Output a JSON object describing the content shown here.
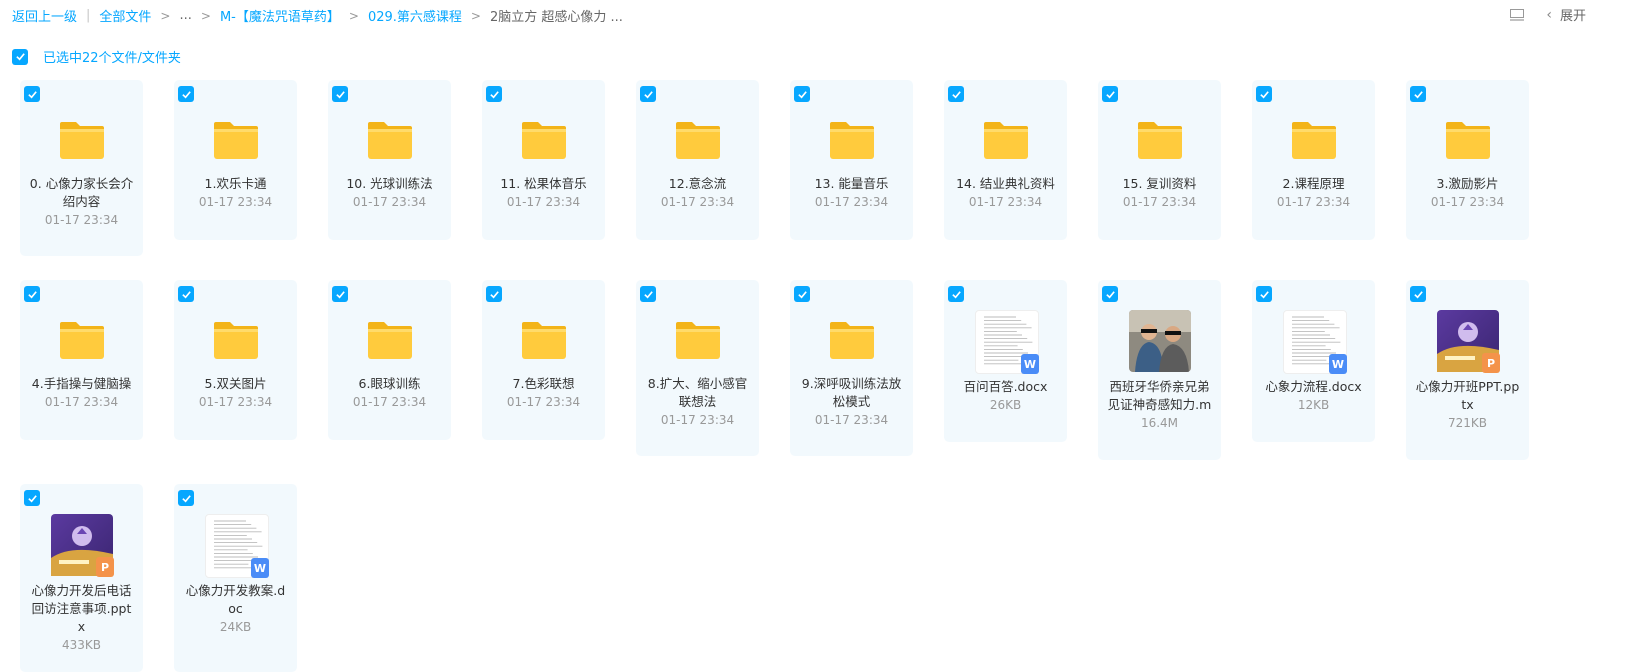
{
  "breadcrumb": {
    "back": "返回上一级",
    "all_files": "全部文件",
    "ellipsis": "...",
    "c1": "M-【魔法咒语草药】",
    "c2": "029.第六感课程",
    "current": "2脑立方 超感心像力 ..."
  },
  "toolbar": {
    "list_icon": "list-view-icon",
    "expand": "展开"
  },
  "selection": {
    "label": "已选中22个文件/文件夹"
  },
  "colors": {
    "accent": "#06a7ff",
    "card_bg": "#f2f9fd",
    "folder": "#ffc933"
  },
  "items": [
    {
      "name": "0. 心像力家长会介绍内容",
      "meta": "01-17 23:34",
      "kind": "folder"
    },
    {
      "name": "1.欢乐卡通",
      "meta": "01-17 23:34",
      "kind": "folder"
    },
    {
      "name": "10. 光球训练法",
      "meta": "01-17 23:34",
      "kind": "folder"
    },
    {
      "name": "11. 松果体音乐",
      "meta": "01-17 23:34",
      "kind": "folder"
    },
    {
      "name": "12.意念流",
      "meta": "01-17 23:34",
      "kind": "folder"
    },
    {
      "name": "13. 能量音乐",
      "meta": "01-17 23:34",
      "kind": "folder"
    },
    {
      "name": "14. 结业典礼资料",
      "meta": "01-17 23:34",
      "kind": "folder"
    },
    {
      "name": "15. 复训资料",
      "meta": "01-17 23:34",
      "kind": "folder"
    },
    {
      "name": "2.课程原理",
      "meta": "01-17 23:34",
      "kind": "folder"
    },
    {
      "name": "3.激励影片",
      "meta": "01-17 23:34",
      "kind": "folder"
    },
    {
      "name": "4.手指操与健脑操",
      "meta": "01-17 23:34",
      "kind": "folder"
    },
    {
      "name": "5.双关图片",
      "meta": "01-17 23:34",
      "kind": "folder"
    },
    {
      "name": "6.眼球训练",
      "meta": "01-17 23:34",
      "kind": "folder"
    },
    {
      "name": "7.色彩联想",
      "meta": "01-17 23:34",
      "kind": "folder"
    },
    {
      "name": "8.扩大、缩小感官联想法",
      "meta": "01-17 23:34",
      "kind": "folder"
    },
    {
      "name": "9.深呼吸训练法放松模式",
      "meta": "01-17 23:34",
      "kind": "folder"
    },
    {
      "name": "百问百答.docx",
      "meta": "26KB",
      "kind": "doc"
    },
    {
      "name": "西班牙华侨亲兄弟见证神奇感知力.m",
      "meta": "16.4M",
      "kind": "video"
    },
    {
      "name": "心象力流程.docx",
      "meta": "12KB",
      "kind": "doc"
    },
    {
      "name": "心像力开班PPT.pptx",
      "meta": "721KB",
      "kind": "ppt"
    },
    {
      "name": "心像力开发后电话回访注意事项.pptx",
      "meta": "433KB",
      "kind": "ppt"
    },
    {
      "name": "心像力开发教案.doc",
      "meta": "24KB",
      "kind": "doc"
    }
  ]
}
